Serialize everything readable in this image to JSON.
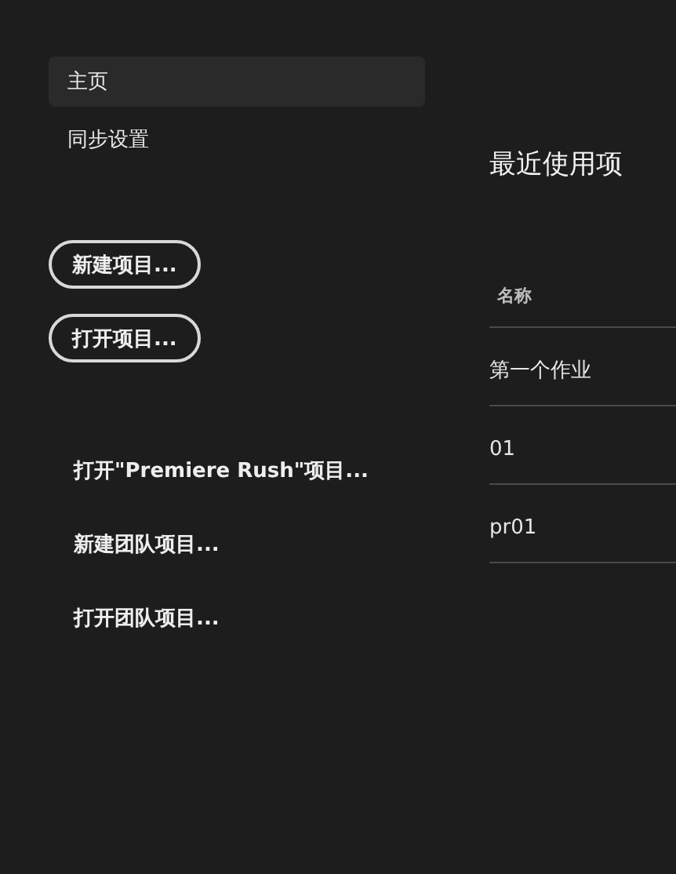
{
  "nav": [
    {
      "label": "主页",
      "selected": true
    },
    {
      "label": "同步设置",
      "selected": false
    }
  ],
  "buttons": [
    "新建项目...",
    "打开项目..."
  ],
  "links": [
    "打开\"Premiere Rush\"项目...",
    "新建团队项目...",
    "打开团队项目..."
  ],
  "recent": {
    "title": "最近使用项",
    "columns": [
      "名称"
    ],
    "rows": [
      [
        "第一个作业"
      ],
      [
        "01"
      ],
      [
        "pr01"
      ]
    ]
  }
}
